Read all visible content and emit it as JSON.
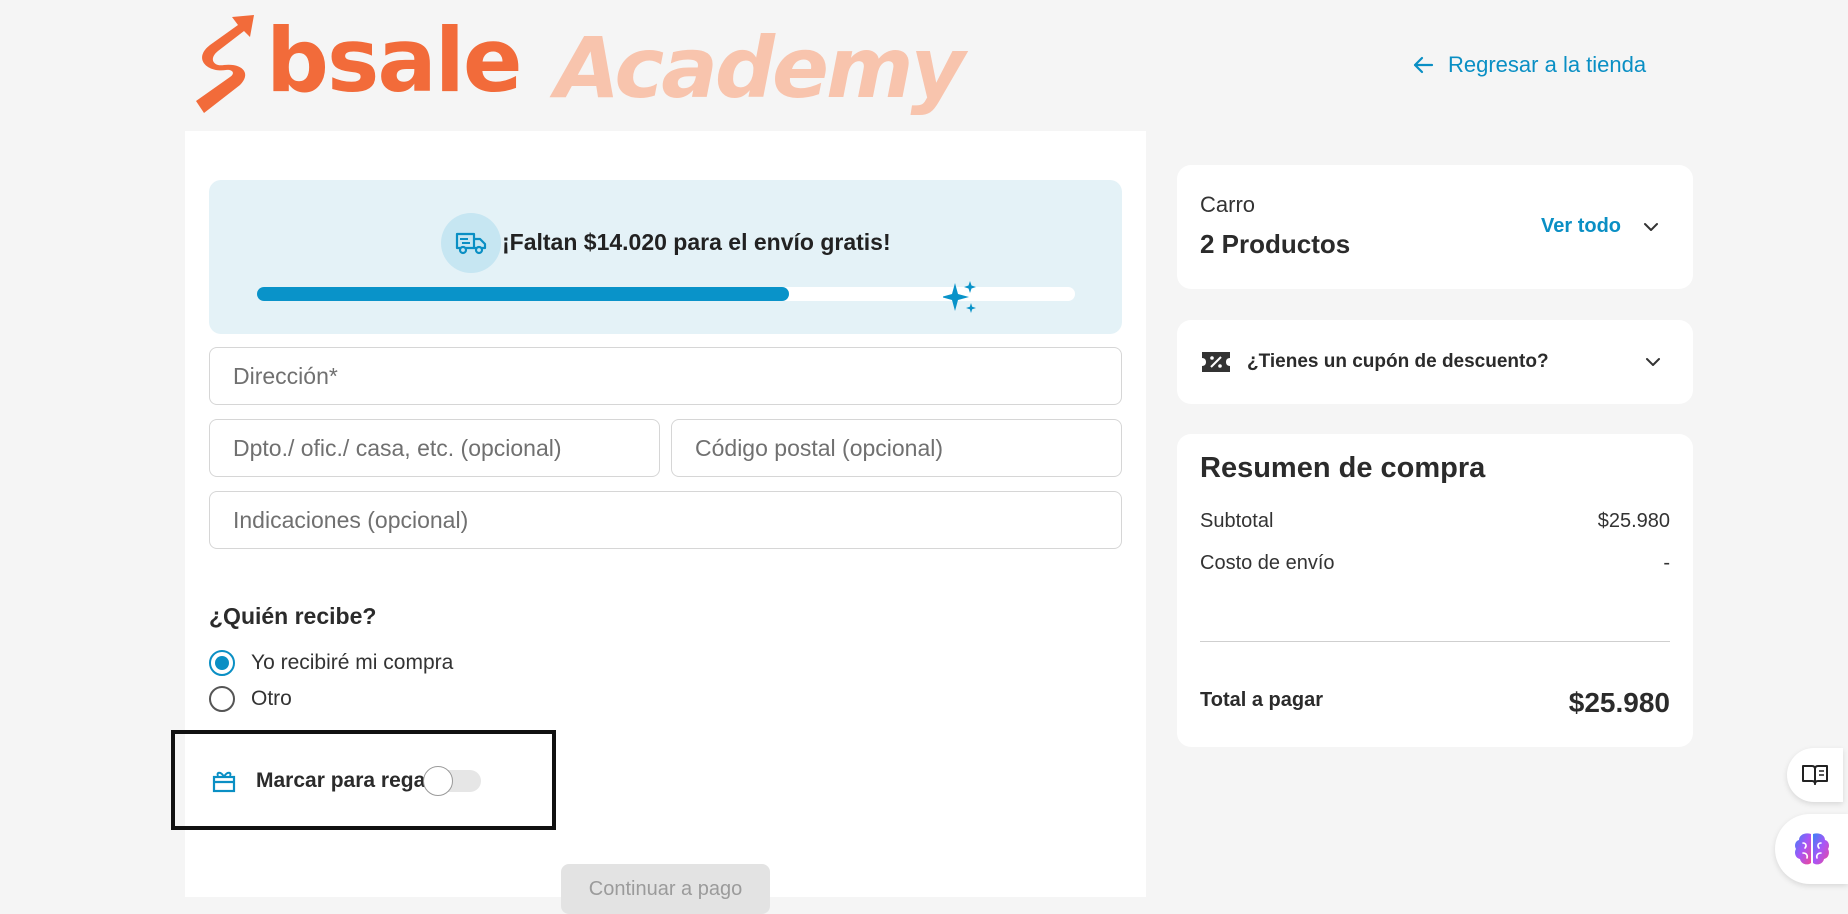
{
  "header": {
    "brand": "bsale",
    "brand_sub": "Academy",
    "back_link": "Regresar a la tienda"
  },
  "shipping_banner": {
    "message": "¡Faltan $14.020 para el envío gratis!",
    "progress": 0.65
  },
  "address_form": {
    "direccion_placeholder": "Dirección*",
    "depto_placeholder": "Dpto./ ofic./ casa, etc. (opcional)",
    "codigo_postal_placeholder": "Código postal (opcional)",
    "indicaciones_placeholder": "Indicaciones (opcional)"
  },
  "recipient": {
    "title": "¿Quién recibe?",
    "options": [
      {
        "label": "Yo recibiré mi compra",
        "checked": true
      },
      {
        "label": "Otro",
        "checked": false
      }
    ]
  },
  "gift": {
    "label": "Marcar para regalo",
    "enabled": false
  },
  "continue_button": "Continuar a pago",
  "cart": {
    "label": "Carro",
    "count": "2 Productos",
    "view_all": "Ver todo"
  },
  "coupon": {
    "label": "¿Tienes un cupón de descuento?"
  },
  "summary": {
    "title": "Resumen de compra",
    "subtotal_label": "Subtotal",
    "subtotal_value": "$25.980",
    "shipping_label": "Costo de envío",
    "shipping_value": "-",
    "total_label": "Total a pagar",
    "total_value": "$25.980"
  },
  "colors": {
    "accent": "#0a8fc4",
    "brand_orange": "#f26b3a",
    "academy_peach": "#f8c4ad",
    "banner_bg": "#e4f2f7"
  }
}
